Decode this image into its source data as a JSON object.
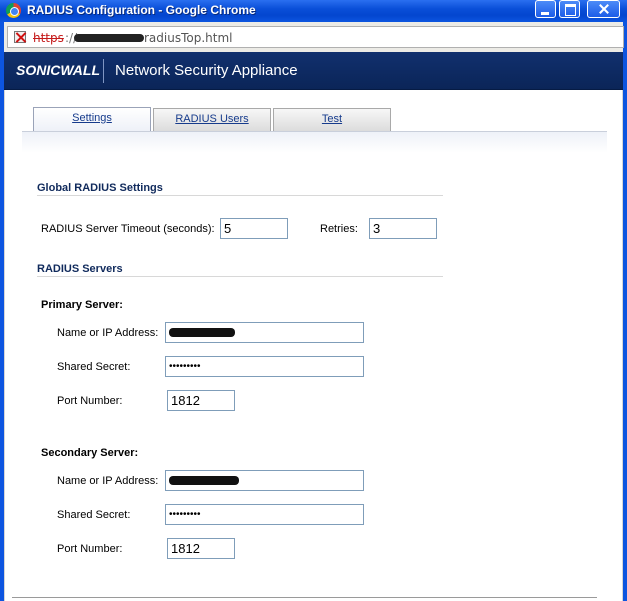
{
  "window": {
    "title": "RADIUS Configuration - Google Chrome"
  },
  "address_bar": {
    "scheme": "https",
    "separator": "://",
    "path": "radiusTop.html"
  },
  "header": {
    "logo": "SONICWALL",
    "product": "Network Security Appliance",
    "brand_color": "#0b2558"
  },
  "tabs": [
    {
      "label": "Settings",
      "active": true
    },
    {
      "label": "RADIUS Users",
      "active": false
    },
    {
      "label": "Test",
      "active": false
    }
  ],
  "global_settings": {
    "heading": "Global RADIUS Settings",
    "timeout_label": "RADIUS Server Timeout (seconds):",
    "timeout_value": "5",
    "retries_label": "Retries:",
    "retries_value": "3"
  },
  "servers": {
    "heading": "RADIUS Servers",
    "primary": {
      "heading": "Primary Server:",
      "name_label": "Name or IP Address:",
      "secret_label": "Shared Secret:",
      "secret_value": "•••••••••",
      "port_label": "Port Number:",
      "port_value": "1812"
    },
    "secondary": {
      "heading": "Secondary Server:",
      "name_label": "Name or IP Address:",
      "secret_label": "Shared Secret:",
      "secret_value": "•••••••••",
      "port_label": "Port Number:",
      "port_value": "1812"
    }
  }
}
